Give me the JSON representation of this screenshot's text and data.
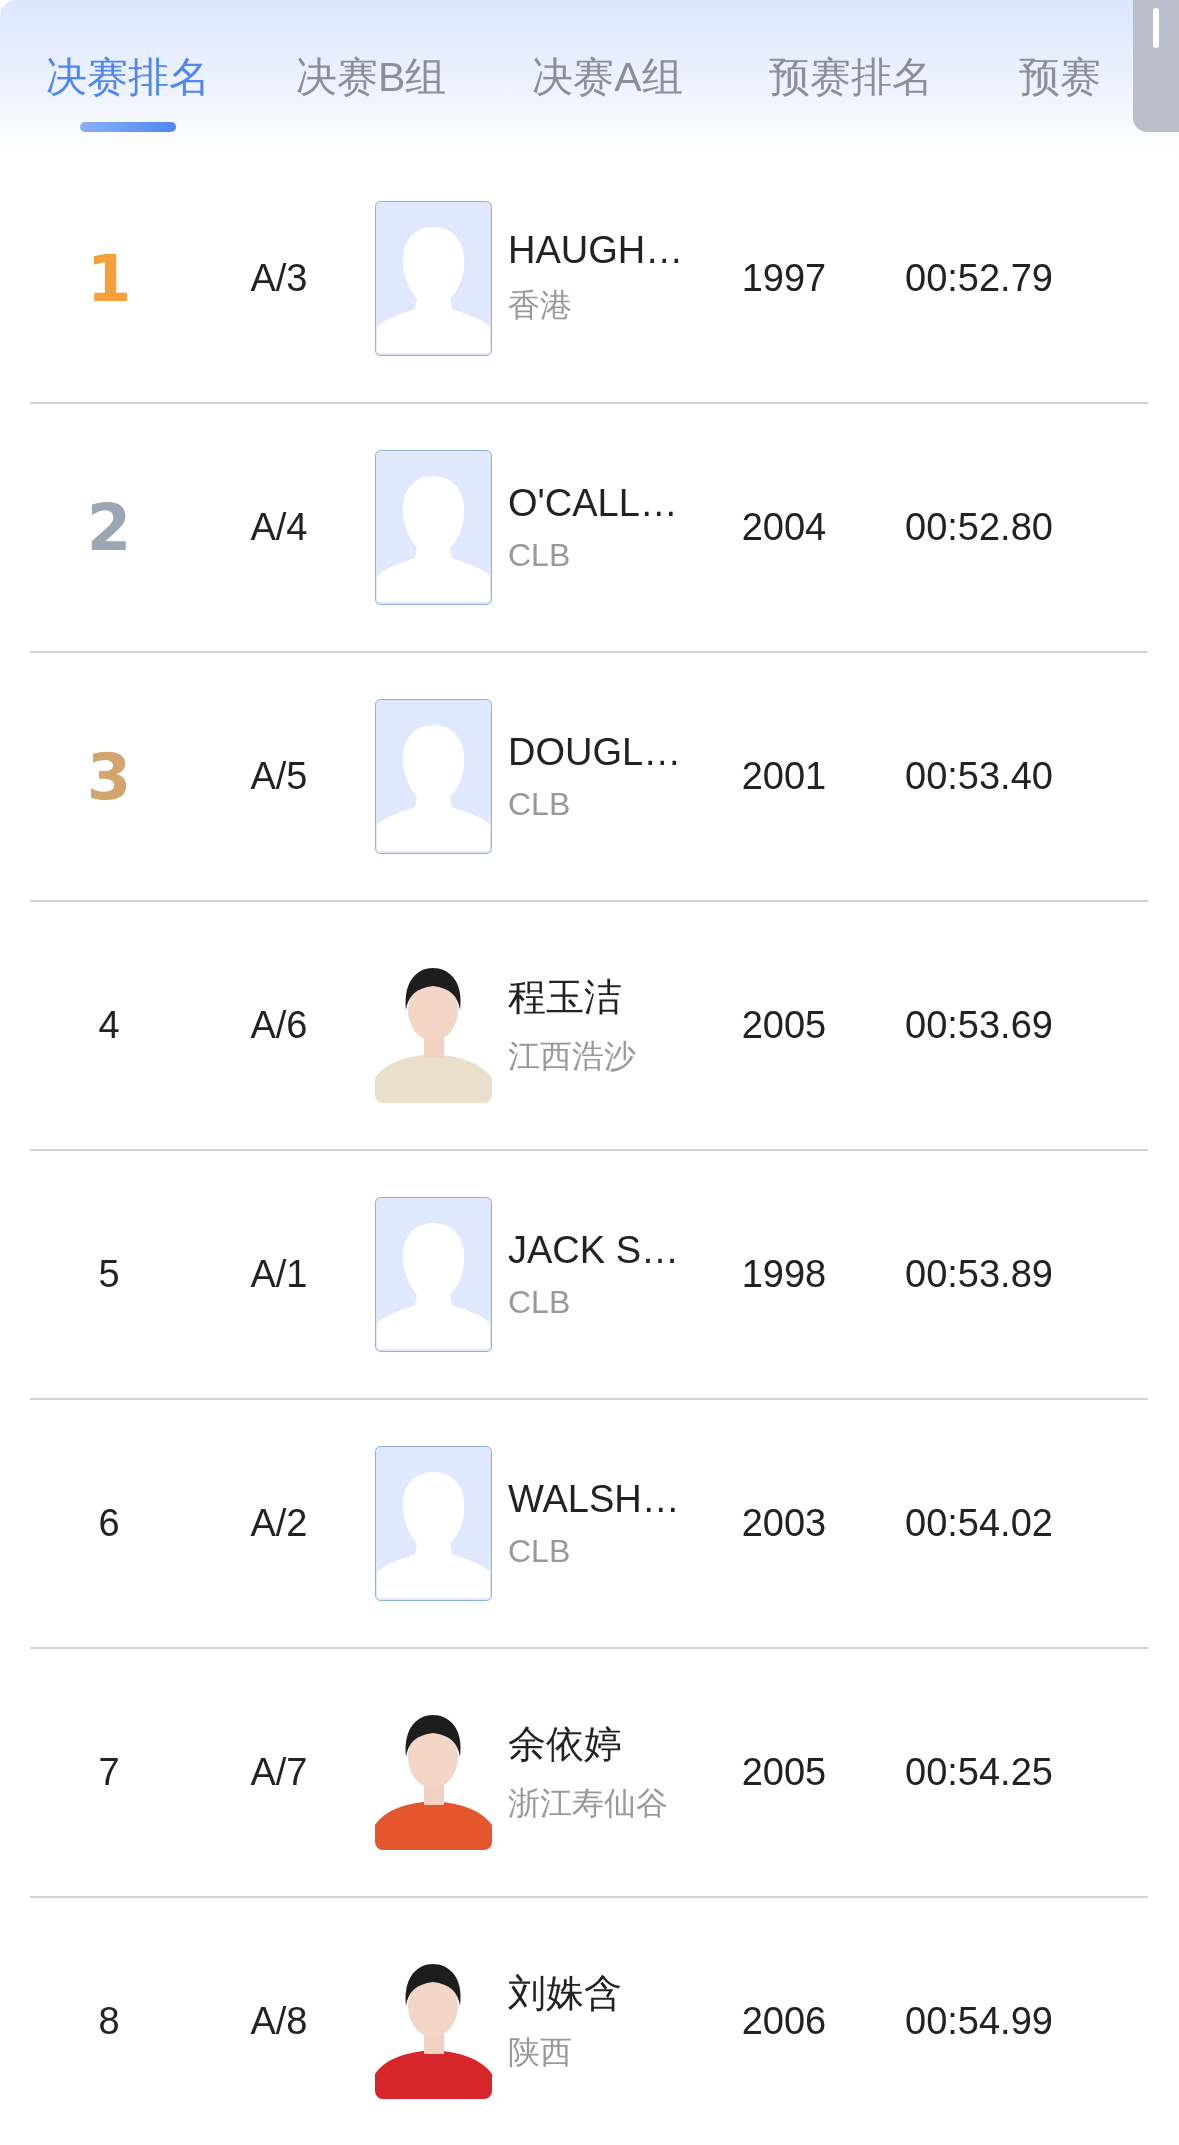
{
  "tabs": [
    {
      "label": "决赛排名",
      "selected": true
    },
    {
      "label": "决赛B组",
      "selected": false
    },
    {
      "label": "决赛A组",
      "selected": false
    },
    {
      "label": "预赛排名",
      "selected": false
    },
    {
      "label": "预赛",
      "selected": false
    }
  ],
  "rows": [
    {
      "rank": {
        "text": "1",
        "color": "#f5a03a"
      },
      "lane": "A/3",
      "avatar": {
        "kind": "placeholder"
      },
      "name": "HAUGH…",
      "team": "香港",
      "year": "1997",
      "time": "00:52.79"
    },
    {
      "rank": {
        "text": "2",
        "color": "#9aa6b2"
      },
      "lane": "A/4",
      "avatar": {
        "kind": "placeholder"
      },
      "name": "O'CALL…",
      "team": "CLB",
      "year": "2004",
      "time": "00:52.80"
    },
    {
      "rank": {
        "text": "3",
        "color": "#d2a46e"
      },
      "lane": "A/5",
      "avatar": {
        "kind": "placeholder"
      },
      "name": "DOUGL…",
      "team": "CLB",
      "year": "2001",
      "time": "00:53.40"
    },
    {
      "rank": {
        "text": "4"
      },
      "lane": "A/6",
      "name": "程玉洁",
      "team": "江西浩沙",
      "year": "2005",
      "time": "00:53.69"
    },
    {
      "rank": {
        "text": "5"
      },
      "lane": "A/1",
      "avatar": {
        "kind": "placeholder"
      },
      "name": "JACK S…",
      "team": "CLB",
      "year": "1998",
      "time": "00:53.89"
    },
    {
      "rank": {
        "text": "6"
      },
      "lane": "A/2",
      "avatar": {
        "kind": "placeholder"
      },
      "name": "WALSH…",
      "team": "CLB",
      "year": "2003",
      "time": "00:54.02"
    },
    {
      "rank": {
        "text": "7"
      },
      "lane": "A/7",
      "name": "余依婷",
      "team": "浙江寿仙谷",
      "year": "2005",
      "time": "00:54.25"
    },
    {
      "rank": {
        "text": "8"
      },
      "lane": "A/8",
      "name": "刘姝含",
      "team": "陕西",
      "year": "2006",
      "time": "00:54.99"
    }
  ]
}
